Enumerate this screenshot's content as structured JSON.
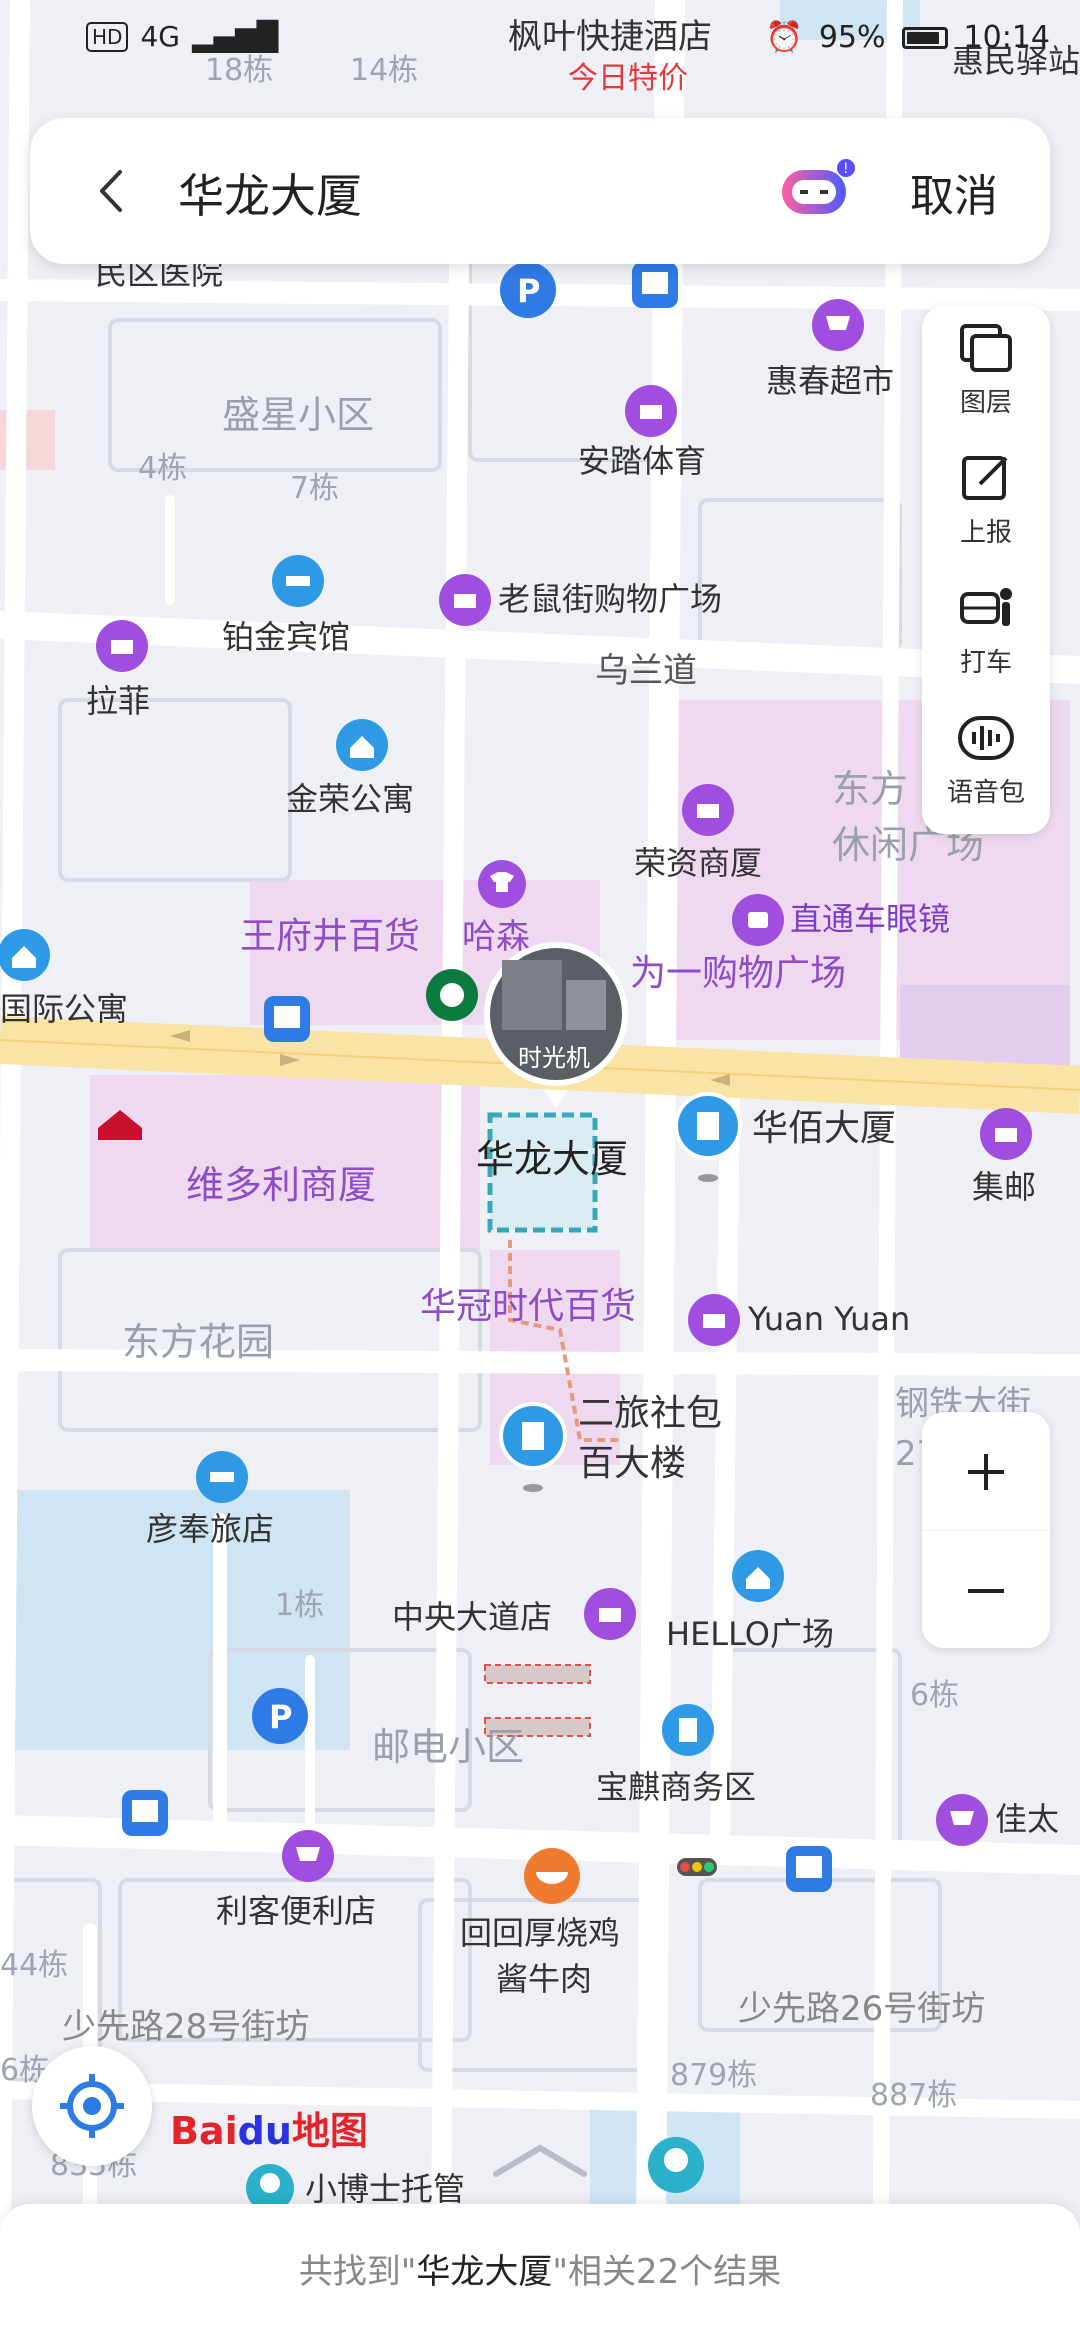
{
  "status_bar": {
    "left_badges": [
      "HD",
      "4G"
    ],
    "banner_title": "枫叶快捷酒店",
    "banner_subtitle": "今日特价",
    "battery": "95%",
    "time": "10:14"
  },
  "search": {
    "query": "华龙大厦",
    "cancel_label": "取消"
  },
  "tools": [
    {
      "label": "图层",
      "icon": "layers-icon"
    },
    {
      "label": "上报",
      "icon": "edit-report-icon"
    },
    {
      "label": "打车",
      "icon": "taxi-icon"
    },
    {
      "label": "语音包",
      "icon": "voice-pack-icon"
    }
  ],
  "streetview_label": "时光机",
  "selected_label": "华龙大厦",
  "logo": {
    "bai": "Bai",
    "du": "du",
    "ditu": "地图"
  },
  "result_text": {
    "prefix": "共找到\"",
    "query": "华龙大厦",
    "suffix": "\"相关22个结果"
  },
  "map": {
    "road_labels": [
      {
        "text": "乌兰道",
        "color": "#555"
      },
      {
        "text": "少先路28号街坊",
        "color": "#888"
      },
      {
        "text": "少先路26号街坊",
        "color": "#888"
      }
    ],
    "area_labels": [
      {
        "text": "盛星小区"
      },
      {
        "text": "东方花园"
      },
      {
        "text": "邮电小区"
      },
      {
        "text": "东方休闲广场"
      },
      {
        "text": "钢铁大街27号街坊"
      }
    ],
    "building_labels": [
      "18栋",
      "14栋",
      "4栋",
      "7栋",
      "1栋",
      "6栋",
      "879栋",
      "887栋",
      "44栋",
      "835栋",
      "6栋"
    ],
    "pois": [
      {
        "name": "枫叶快捷酒店",
        "icon": "hotel-icon"
      },
      {
        "name": "惠民驿站",
        "icon": "none"
      },
      {
        "name": "民区医院",
        "icon": "none"
      },
      {
        "name": "惠春超市",
        "icon": "cart-icon"
      },
      {
        "name": "安踏体育",
        "icon": "shopping-bag-icon"
      },
      {
        "name": "老鼠街购物广场",
        "icon": "shopping-bag-icon"
      },
      {
        "name": "铂金宾馆",
        "icon": "hotel-icon"
      },
      {
        "name": "拉菲",
        "icon": "shopping-bag-icon"
      },
      {
        "name": "金荣公寓",
        "icon": "apartment-icon"
      },
      {
        "name": "荣资商厦",
        "icon": "shopping-bag-icon"
      },
      {
        "name": "直通车眼镜",
        "icon": "glasses-shop-icon"
      },
      {
        "name": "王府井百货",
        "icon": "none"
      },
      {
        "name": "哈森",
        "icon": "tshirt-icon"
      },
      {
        "name": "为一购物广场",
        "icon": "none"
      },
      {
        "name": "国际公寓",
        "icon": "apartment-icon"
      },
      {
        "name": "华佰大厦",
        "icon": "building-pin-icon"
      },
      {
        "name": "维多利商厦",
        "icon": "none"
      },
      {
        "name": "集邮",
        "icon": "shopping-bag-icon"
      },
      {
        "name": "华冠时代百货",
        "icon": "none"
      },
      {
        "name": "Yuan Yuan",
        "icon": "shopping-bag-icon"
      },
      {
        "name": "二旅社包百大楼",
        "icon": "building-pin-icon"
      },
      {
        "name": "彦奉旅店",
        "icon": "hotel-icon"
      },
      {
        "name": "中央大道店",
        "icon": "shopping-bag-icon"
      },
      {
        "name": "HELLO广场",
        "icon": "apartment-icon"
      },
      {
        "name": "宝麒商务区",
        "icon": "building-icon"
      },
      {
        "name": "佳太",
        "icon": "cart-icon"
      },
      {
        "name": "利客便利店",
        "icon": "cart-icon"
      },
      {
        "name": "回回厚烧鸡酱牛肉",
        "icon": "food-icon"
      },
      {
        "name": "小博士托管",
        "icon": "tree-icon"
      }
    ],
    "colors": {
      "poi_purple": "#a04ee0",
      "poi_blue": "#2e9ae6",
      "road_yellow": "#f9e3a5",
      "mall_pink": "#efd9f0",
      "water": "#cfe5f3",
      "background": "#eef0f6",
      "selection": "#3aa6b9",
      "accent_red": "#e4393c"
    }
  }
}
